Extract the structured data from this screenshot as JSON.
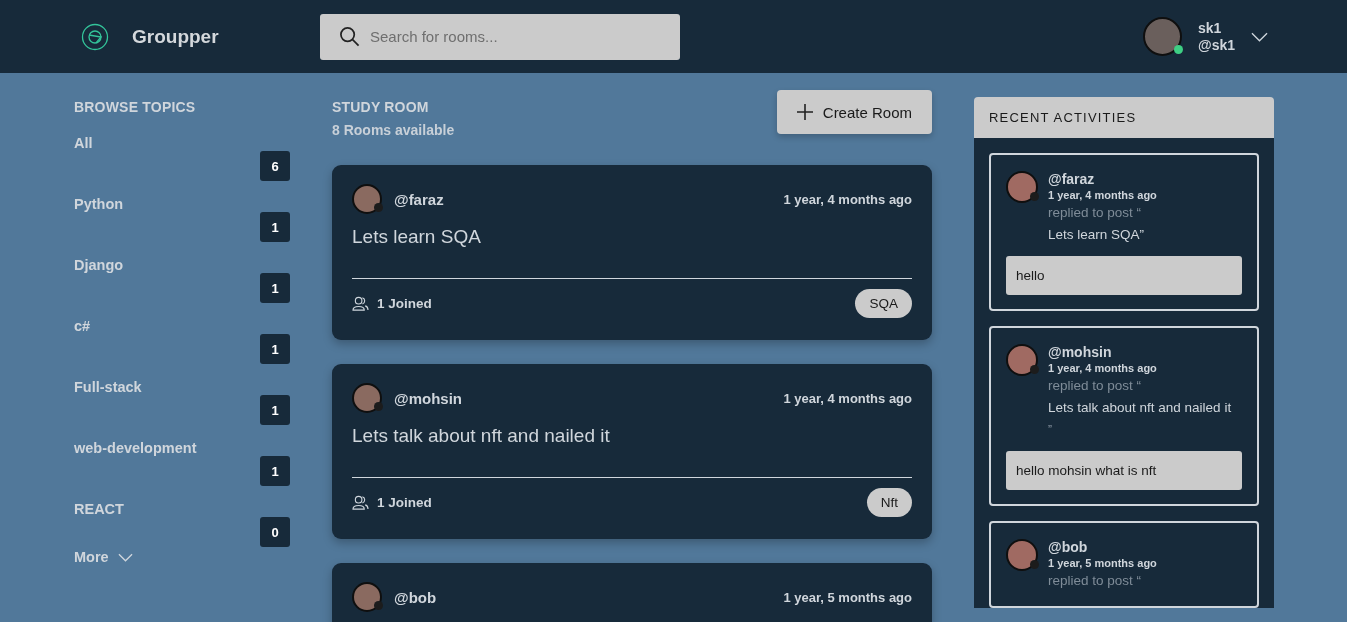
{
  "header": {
    "brand": "Groupper",
    "search": {
      "placeholder": "Search for rooms..."
    },
    "user": {
      "name": "sk1",
      "handle": "@sk1",
      "online": true
    }
  },
  "topics": {
    "title": "BROWSE TOPICS",
    "items": [
      {
        "name": "All",
        "count": "6"
      },
      {
        "name": "Python",
        "count": "1"
      },
      {
        "name": "Django",
        "count": "1"
      },
      {
        "name": "c#",
        "count": "1"
      },
      {
        "name": "Full-stack",
        "count": "1"
      },
      {
        "name": "web-development",
        "count": "1"
      },
      {
        "name": "REACT",
        "count": "0"
      }
    ],
    "more": "More"
  },
  "rooms": {
    "title": "STUDY ROOM",
    "subtitle": "8 Rooms available",
    "create_button": "Create Room",
    "items": [
      {
        "host": "@faraz",
        "online": false,
        "time": "1 year, 4 months ago",
        "name": "Lets learn SQA",
        "joined": "1 Joined",
        "topic": "SQA"
      },
      {
        "host": "@mohsin",
        "online": false,
        "time": "1 year, 4 months ago",
        "name": "Lets talk about nft and nailed it",
        "joined": "1 Joined",
        "topic": "Nft"
      },
      {
        "host": "@bob",
        "online": false,
        "time": "1 year, 5 months ago"
      }
    ]
  },
  "activities": {
    "title": "RECENT ACTIVITIES",
    "items": [
      {
        "user": "@faraz",
        "online": false,
        "time": "1 year, 4 months ago",
        "action": "replied to post “",
        "post": "Lets learn SQA”",
        "message": "hello"
      },
      {
        "user": "@mohsin",
        "online": false,
        "time": "1 year, 4 months ago",
        "action": "replied to post “",
        "post": "Lets talk about nft and nailed it",
        "trailing": "”",
        "message": "hello mohsin what is nft"
      },
      {
        "user": "@bob",
        "online": false,
        "time": "1 year, 5 months ago",
        "action": "replied to post “"
      }
    ]
  }
}
